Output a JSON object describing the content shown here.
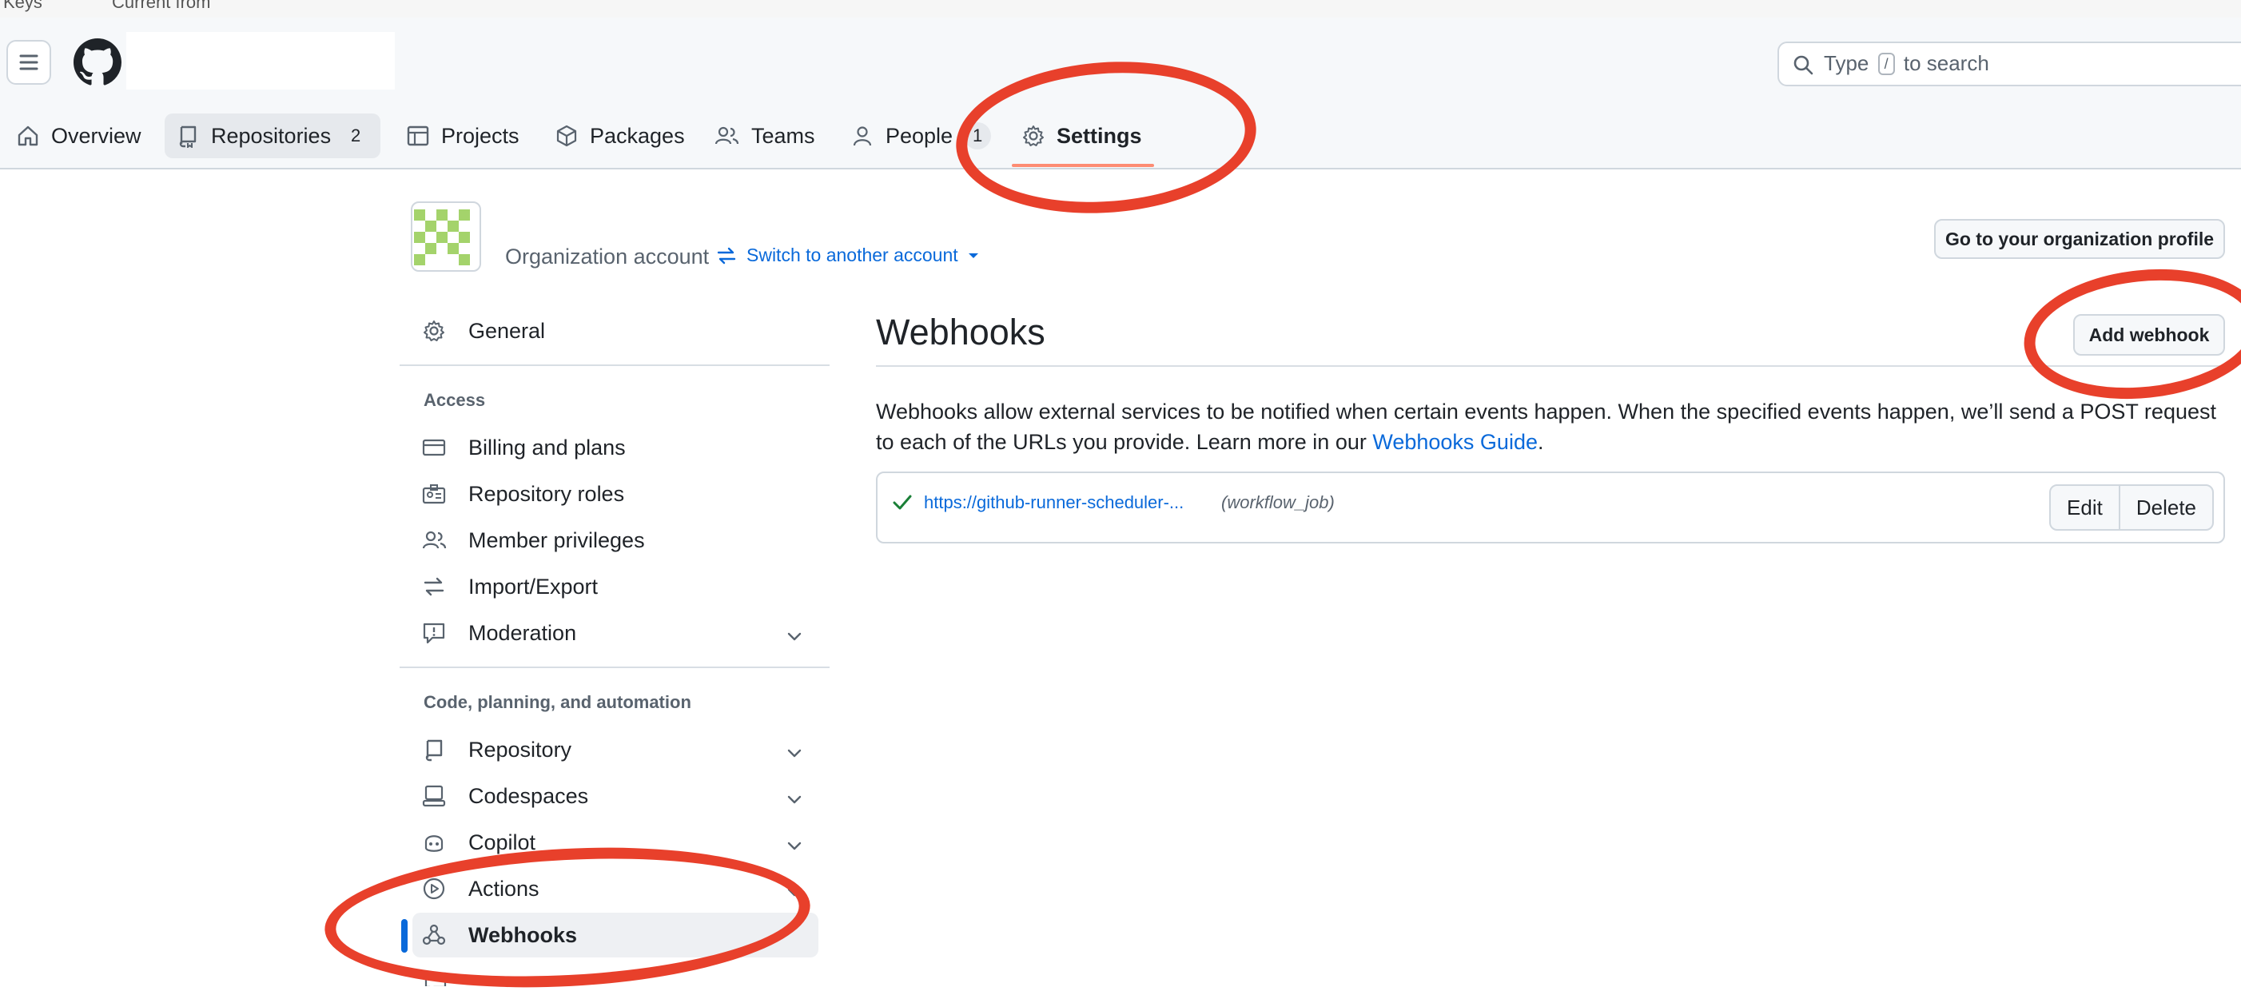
{
  "browser_bar": {
    "bookmarks": [
      "Keys",
      "Current from"
    ]
  },
  "header": {
    "search_text_before": "Type",
    "search_key": "/",
    "search_text_after": "to search"
  },
  "tabs": [
    {
      "label": "Overview"
    },
    {
      "label": "Repositories",
      "count": "2"
    },
    {
      "label": "Projects"
    },
    {
      "label": "Packages"
    },
    {
      "label": "Teams"
    },
    {
      "label": "People",
      "count": "1"
    },
    {
      "label": "Settings"
    }
  ],
  "account": {
    "type_label": "Organization account",
    "switch_label": "Switch to another account",
    "profile_button": "Go to your organization profile"
  },
  "sidebar": {
    "general": "General",
    "access_heading": "Access",
    "access_items": [
      "Billing and plans",
      "Repository roles",
      "Member privileges",
      "Import/Export",
      "Moderation"
    ],
    "code_heading": "Code, planning, and automation",
    "code_items": [
      "Repository",
      "Codespaces",
      "Copilot",
      "Actions",
      "Webhooks"
    ]
  },
  "main": {
    "title": "Webhooks",
    "add_button": "Add webhook",
    "desc_text": "Webhooks allow external services to be notified when certain events happen. When the specified events happen, we’ll send a POST request to each of the URLs you provide. Learn more in our ",
    "desc_link": "Webhooks Guide",
    "desc_end": ".",
    "webhook": {
      "url": "https://github-runner-scheduler-...",
      "events": "(workflow_job)",
      "edit": "Edit",
      "delete": "Delete"
    }
  },
  "colors": {
    "accent_link": "#0969da",
    "annotation_red": "#e8402b",
    "active_tab_underline": "#fd8c73",
    "success": "#1a7f37"
  }
}
